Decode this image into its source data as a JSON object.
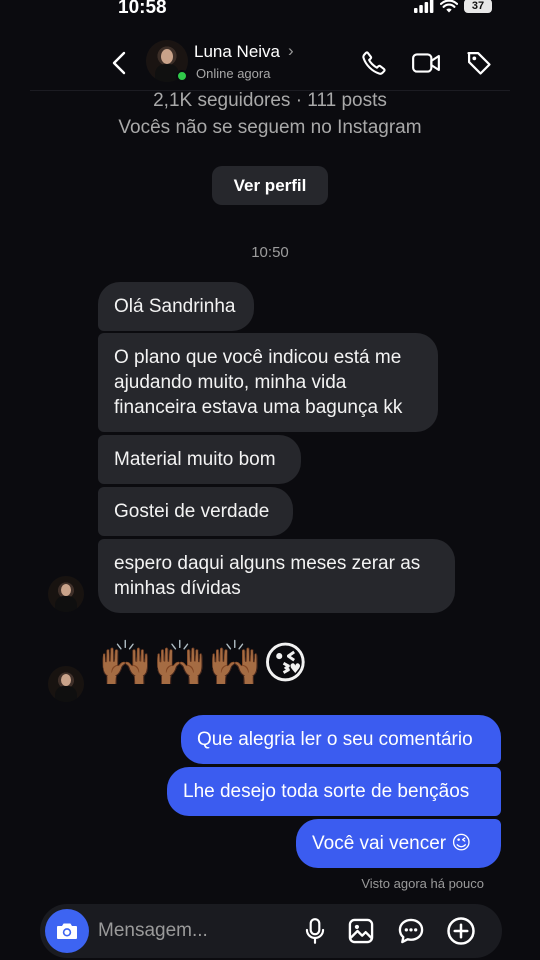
{
  "status_bar": {
    "time": "10:58",
    "battery": "37"
  },
  "header": {
    "name": "Luna Neiva",
    "chevron": "›",
    "status": "Online agora",
    "icons": [
      "back-icon",
      "phone-icon",
      "video-camera-icon",
      "tag-icon"
    ]
  },
  "profile": {
    "followers": "2,1K seguidores · 111 posts",
    "relation": "Vocês não se seguem no Instagram",
    "view_profile_label": "Ver perfil"
  },
  "conversation": {
    "timestamp": "10:50",
    "incoming": [
      "Olá Sandrinha",
      "O plano que você indicou está me ajudando muito, minha vida financeira estava uma bagunça kk",
      "Material muito bom",
      "Gostei de verdade",
      "espero daqui alguns meses zerar as minhas dívidas"
    ],
    "emoji_message": [
      "🙌🏾",
      "🙌🏾",
      "🙌🏾",
      "😘"
    ],
    "outgoing": [
      "Que alegria ler o seu comentário",
      "Lhe desejo toda sorte de bençãos",
      "Você vai vencer 😉"
    ],
    "seen": "Visto agora há pouco"
  },
  "composer": {
    "placeholder": "Mensagem...",
    "icons": [
      "camera-icon",
      "microphone-icon",
      "image-icon",
      "sticker-icon",
      "plus-icon"
    ]
  },
  "colors": {
    "background": "#0b0b0f",
    "incoming_bubble": "#26272c",
    "outgoing_bubble": "#3b5cf0",
    "online": "#30c94a",
    "camera_button": "#3d64f2"
  }
}
